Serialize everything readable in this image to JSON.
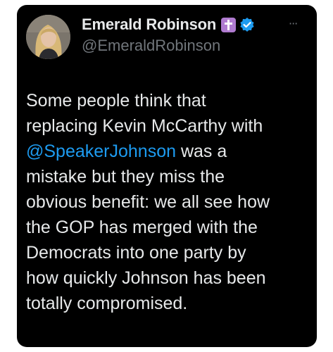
{
  "author": {
    "display_name": "Emerald Robinson",
    "handle": "@EmeraldRobinson",
    "avatar_icon": "profile-photo",
    "badges": [
      "cross-icon",
      "verified-icon"
    ],
    "colors": {
      "cross_badge": "#b07bd0",
      "verified_badge": "#1d9bf0"
    }
  },
  "more_label": "···",
  "tweet": {
    "lines": [
      {
        "text": "Some people think that"
      },
      {
        "text": "replacing Kevin McCarthy with"
      },
      {
        "mention": "@SpeakerJohnson",
        "text": " was a"
      },
      {
        "text": "mistake but they miss the"
      },
      {
        "text": "obvious benefit: we all see how"
      },
      {
        "text": "the GOP has merged with the"
      },
      {
        "text": "Democrats into one party by"
      },
      {
        "text": "how quickly Johnson has been"
      },
      {
        "text": "totally compromised."
      }
    ],
    "mention_color": "#1d9bf0"
  }
}
